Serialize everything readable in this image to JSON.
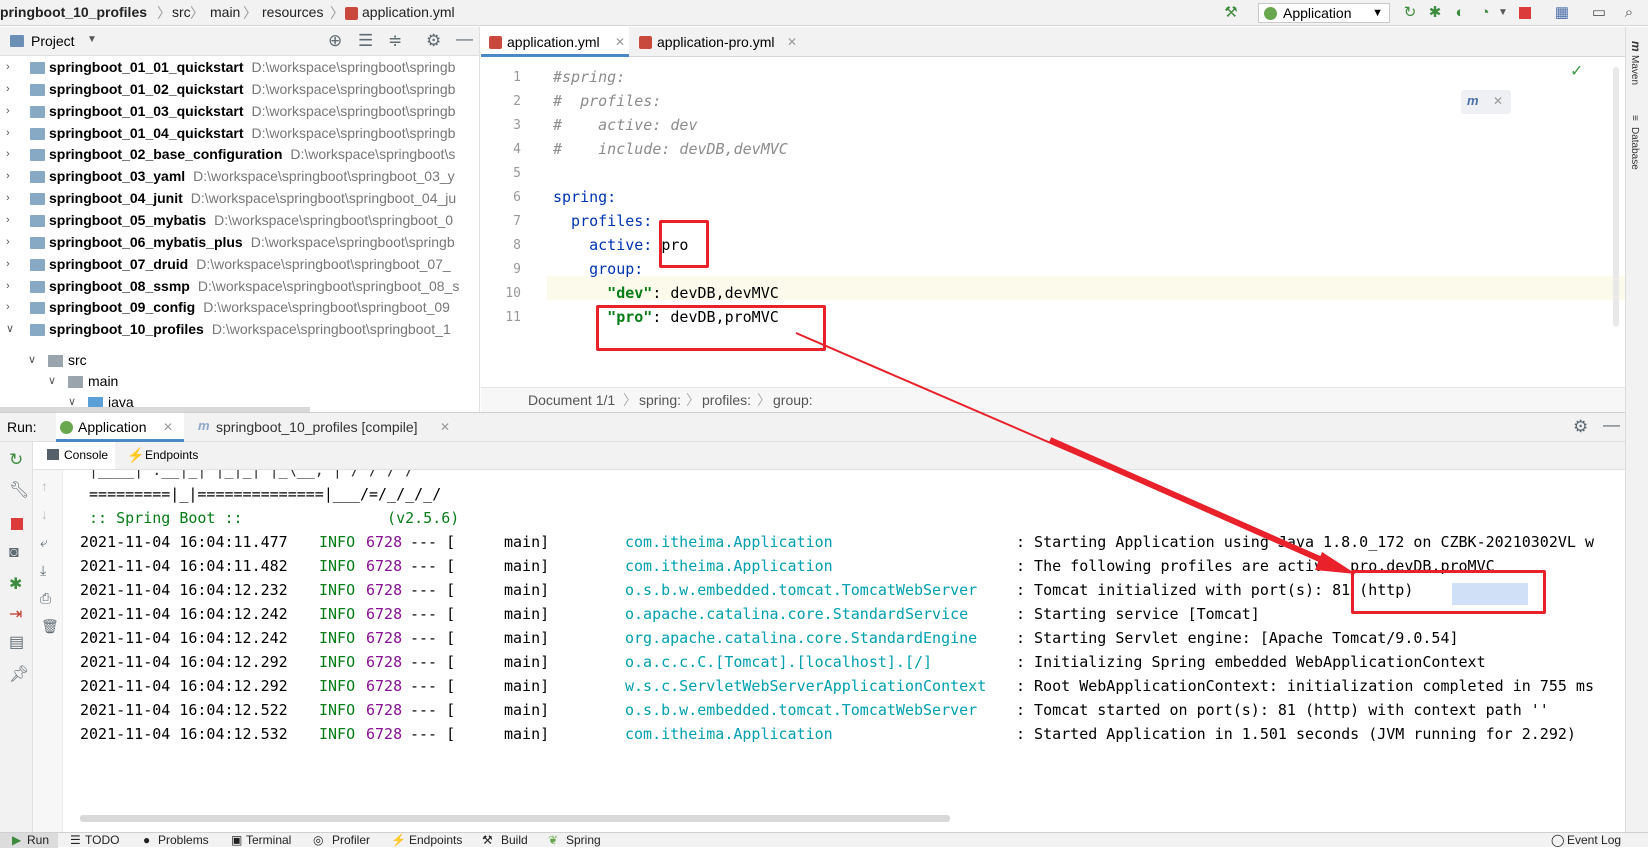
{
  "breadcrumb": [
    "pringboot_10_profiles",
    "src",
    "main",
    "resources",
    "application.yml"
  ],
  "run_config": "Application",
  "project_panel": {
    "title": "Project",
    "items": [
      {
        "name": "springboot_01_01_quickstart",
        "path": "D:\\workspace\\springboot\\springb"
      },
      {
        "name": "springboot_01_02_quickstart",
        "path": "D:\\workspace\\springboot\\springb"
      },
      {
        "name": "springboot_01_03_quickstart",
        "path": "D:\\workspace\\springboot\\springb"
      },
      {
        "name": "springboot_01_04_quickstart",
        "path": "D:\\workspace\\springboot\\springb"
      },
      {
        "name": "springboot_02_base_configuration",
        "path": "D:\\workspace\\springboot\\s"
      },
      {
        "name": "springboot_03_yaml",
        "path": "D:\\workspace\\springboot\\springboot_03_y"
      },
      {
        "name": "springboot_04_junit",
        "path": "D:\\workspace\\springboot\\springboot_04_ju"
      },
      {
        "name": "springboot_05_mybatis",
        "path": "D:\\workspace\\springboot\\springboot_0"
      },
      {
        "name": "springboot_06_mybatis_plus",
        "path": "D:\\workspace\\springboot\\springb"
      },
      {
        "name": "springboot_07_druid",
        "path": "D:\\workspace\\springboot\\springboot_07_"
      },
      {
        "name": "springboot_08_ssmp",
        "path": "D:\\workspace\\springboot\\springboot_08_s"
      },
      {
        "name": "springboot_09_config",
        "path": "D:\\workspace\\springboot\\springboot_09"
      },
      {
        "name": "springboot_10_profiles",
        "path": "D:\\workspace\\springboot\\springboot_1"
      }
    ],
    "children": [
      "src",
      "main",
      "java"
    ]
  },
  "editor": {
    "tabs": [
      "application.yml",
      "application-pro.yml"
    ],
    "lines": [
      {
        "num": "1",
        "parts": [
          {
            "t": "#spring:",
            "c": "cm"
          }
        ]
      },
      {
        "num": "2",
        "parts": [
          {
            "t": "#  profiles:",
            "c": "cm"
          }
        ]
      },
      {
        "num": "3",
        "parts": [
          {
            "t": "#    active: dev",
            "c": "cm"
          }
        ]
      },
      {
        "num": "4",
        "parts": [
          {
            "t": "#    include: devDB,devMVC",
            "c": "cm"
          }
        ]
      },
      {
        "num": "5",
        "parts": []
      },
      {
        "num": "6",
        "parts": [
          {
            "t": "spring:",
            "c": "key"
          }
        ]
      },
      {
        "num": "7",
        "parts": [
          {
            "t": "  profiles:",
            "c": "key"
          }
        ]
      },
      {
        "num": "8",
        "parts": [
          {
            "t": "    active:",
            "c": "key"
          },
          {
            "t": " pro",
            "c": ""
          }
        ]
      },
      {
        "num": "9",
        "parts": [
          {
            "t": "    group:",
            "c": "key"
          }
        ]
      },
      {
        "num": "10",
        "parts": [
          {
            "t": "      \"dev\"",
            "c": "str"
          },
          {
            "t": ": devDB,devMVC",
            "c": ""
          }
        ]
      },
      {
        "num": "11",
        "parts": [
          {
            "t": "      \"pro\"",
            "c": "str"
          },
          {
            "t": ": devDB,proMVC",
            "c": ""
          }
        ]
      }
    ],
    "status_breadcrumb": [
      "Document 1/1",
      "spring:",
      "profiles:",
      "group:"
    ]
  },
  "run_panel": {
    "label": "Run:",
    "tabs": [
      "Application",
      "springboot_10_profiles [compile]"
    ],
    "subtabs": [
      "Console",
      "Endpoints"
    ],
    "banner": [
      " =========|_|==============|___/=/_/_/_/",
      " :: Spring Boot ::                (v2.5.6)"
    ],
    "logs": [
      {
        "date": "2021-11-04 16:04:11.477",
        "level": "INFO",
        "pid": "6728",
        "dash": "--- [",
        "thread": "main]",
        "logger": "com.itheima.Application",
        "msg": ": Starting Application using Java 1.8.0_172 on CZBK-20210302VL w"
      },
      {
        "date": "2021-11-04 16:04:11.482",
        "level": "INFO",
        "pid": "6728",
        "dash": "--- [",
        "thread": "main]",
        "logger": "com.itheima.Application",
        "msg": ": The following profiles are active: pro,devDB,proMVC"
      },
      {
        "date": "2021-11-04 16:04:12.232",
        "level": "INFO",
        "pid": "6728",
        "dash": "--- [",
        "thread": "main]",
        "logger": "o.s.b.w.embedded.tomcat.TomcatWebServer",
        "msg": ": Tomcat initialized with port(s): 81 (http)"
      },
      {
        "date": "2021-11-04 16:04:12.242",
        "level": "INFO",
        "pid": "6728",
        "dash": "--- [",
        "thread": "main]",
        "logger": "o.apache.catalina.core.StandardService",
        "msg": ": Starting service [Tomcat]"
      },
      {
        "date": "2021-11-04 16:04:12.242",
        "level": "INFO",
        "pid": "6728",
        "dash": "--- [",
        "thread": "main]",
        "logger": "org.apache.catalina.core.StandardEngine",
        "msg": ": Starting Servlet engine: [Apache Tomcat/9.0.54]"
      },
      {
        "date": "2021-11-04 16:04:12.292",
        "level": "INFO",
        "pid": "6728",
        "dash": "--- [",
        "thread": "main]",
        "logger": "o.a.c.c.C.[Tomcat].[localhost].[/]",
        "msg": ": Initializing Spring embedded WebApplicationContext"
      },
      {
        "date": "2021-11-04 16:04:12.292",
        "level": "INFO",
        "pid": "6728",
        "dash": "--- [",
        "thread": "main]",
        "logger": "w.s.c.ServletWebServerApplicationContext",
        "msg": ": Root WebApplicationContext: initialization completed in 755 ms"
      },
      {
        "date": "2021-11-04 16:04:12.522",
        "level": "INFO",
        "pid": "6728",
        "dash": "--- [",
        "thread": "main]",
        "logger": "o.s.b.w.embedded.tomcat.TomcatWebServer",
        "msg": ": Tomcat started on port(s): 81 (http) with context path ''"
      },
      {
        "date": "2021-11-04 16:04:12.532",
        "level": "INFO",
        "pid": "6728",
        "dash": "--- [",
        "thread": "main]",
        "logger": "com.itheima.Application",
        "msg": ": Started Application in 1.501 seconds (JVM running for 2.292)"
      }
    ]
  },
  "right_strip": [
    "Maven",
    "Database"
  ],
  "status_bar": {
    "left": [
      "Run",
      "TODO",
      "Problems",
      "Terminal",
      "Profiler",
      "Endpoints",
      "Build",
      "Spring"
    ],
    "right": "Event Log"
  },
  "colors": {
    "annotation": "#e8212b",
    "accent": "#4a88c7"
  }
}
